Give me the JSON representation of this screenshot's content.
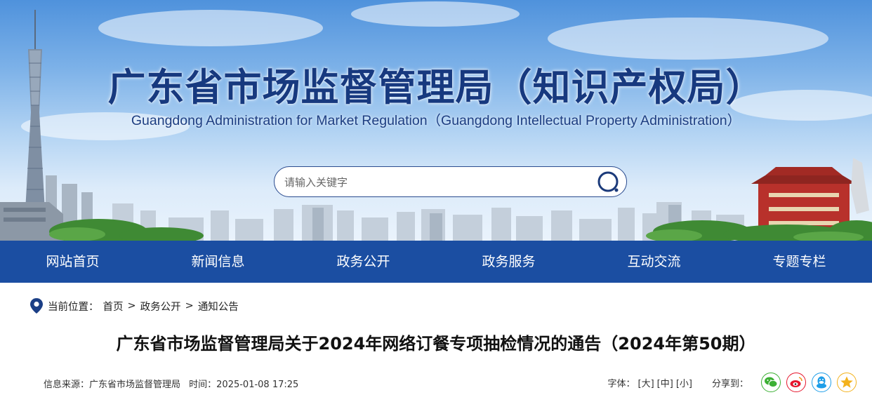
{
  "header": {
    "title_cn": "广东省市场监督管理局（知识产权局）",
    "title_en": "Guangdong Administration for Market Regulation（Guangdong Intellectual Property Administration）"
  },
  "search": {
    "placeholder": "请输入关键字",
    "icon": "search-icon"
  },
  "nav": {
    "items": [
      "网站首页",
      "新闻信息",
      "政务公开",
      "政务服务",
      "互动交流",
      "专题专栏"
    ]
  },
  "breadcrumb": {
    "label": "当前位置：",
    "icon": "location-pin-icon",
    "items": [
      "首页",
      "政务公开",
      "通知公告"
    ],
    "separator": ">"
  },
  "article": {
    "title": "广东省市场监督管理局关于2024年网络订餐专项抽检情况的通告（2024年第50期）",
    "source": "信息来源：广东省市场监督管理局",
    "time": "时间：2025-01-08 17:25"
  },
  "tools": {
    "font_label": "字体：",
    "font_sizes": [
      "[大]",
      "[中]",
      "[小]"
    ],
    "share_label": "分享到：",
    "share_icons": [
      "wechat-icon",
      "weibo-icon",
      "qq-icon",
      "qzone-icon"
    ]
  },
  "colors": {
    "nav_bg": "#1b4ea2",
    "title_blue": "#17397f",
    "wechat": "#3cb034",
    "weibo": "#e6162d",
    "qq": "#1e9ee8",
    "qzone": "#f3b21d"
  }
}
